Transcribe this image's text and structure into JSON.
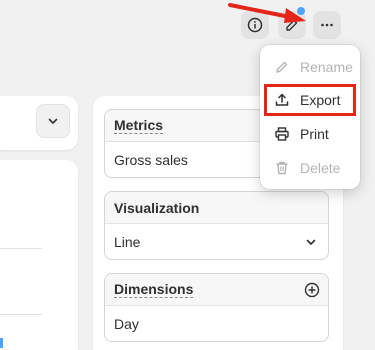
{
  "menu": {
    "items": [
      {
        "label": "Rename",
        "icon": "pencil-icon",
        "disabled": true
      },
      {
        "label": "Export",
        "icon": "upload-icon",
        "disabled": false,
        "highlighted": true
      },
      {
        "label": "Print",
        "icon": "printer-icon",
        "disabled": false
      },
      {
        "label": "Delete",
        "icon": "trash-icon",
        "disabled": true
      }
    ]
  },
  "panel": {
    "metrics": {
      "title": "Metrics",
      "value": "Gross sales"
    },
    "visualization": {
      "title": "Visualization",
      "value": "Line"
    },
    "dimensions": {
      "title": "Dimensions",
      "value": "Day"
    }
  },
  "colors": {
    "annotation": "#e4261a",
    "notification_dot": "#4fa3f7",
    "disabled_text": "#b5b5b5"
  }
}
